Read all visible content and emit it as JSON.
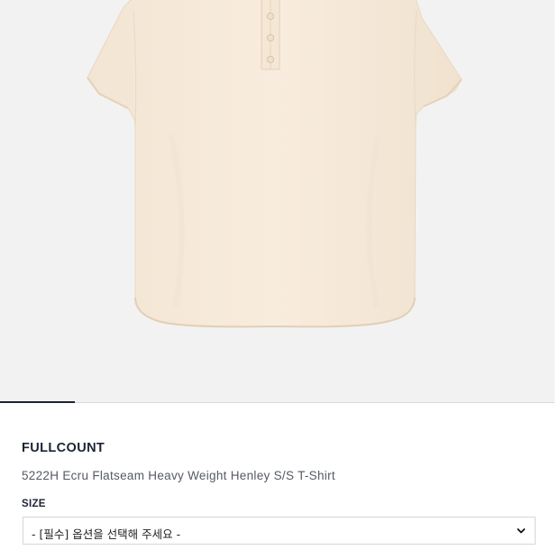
{
  "product": {
    "brand": "FULLCOUNT",
    "name": "5222H Ecru Flatseam Heavy Weight Henley S/S T-Shirt"
  },
  "gallery": {
    "image": "ecru-henley-tshirt-photo",
    "active_slide": 1
  },
  "options": {
    "size": {
      "label": "SIZE",
      "selected": "- [필수] 옵션을 선택해 주세요 -",
      "icon": "chevron-down-icon"
    }
  },
  "colors": {
    "brand_text": "#1c2333",
    "gallery_bg": "#f2f2f2",
    "shirt": "#f6eadb"
  }
}
